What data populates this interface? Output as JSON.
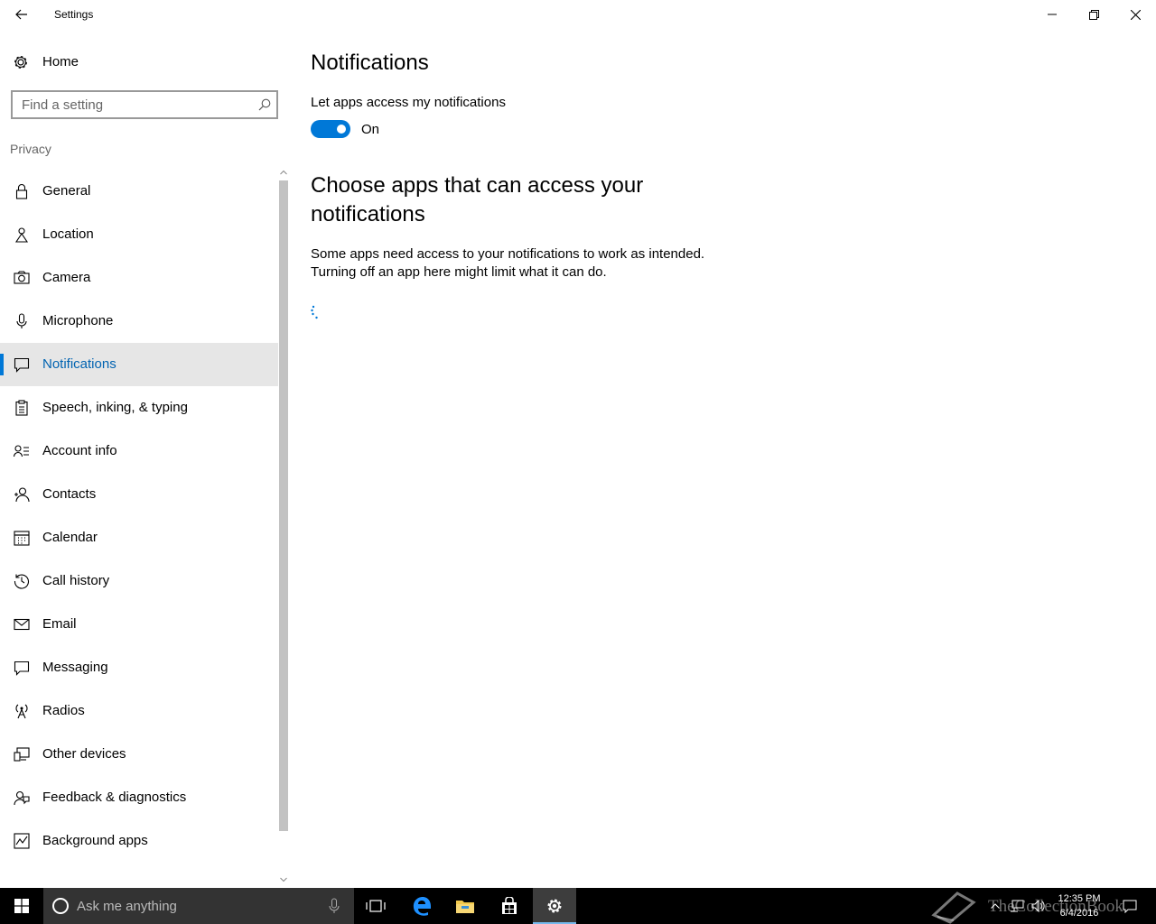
{
  "window": {
    "title": "Settings"
  },
  "sidebar": {
    "home_label": "Home",
    "search_placeholder": "Find a setting",
    "section_label": "Privacy",
    "items": [
      {
        "label": "General",
        "icon": "lock-icon"
      },
      {
        "label": "Location",
        "icon": "location-icon"
      },
      {
        "label": "Camera",
        "icon": "camera-icon"
      },
      {
        "label": "Microphone",
        "icon": "microphone-icon"
      },
      {
        "label": "Notifications",
        "icon": "notification-icon",
        "selected": true
      },
      {
        "label": "Speech, inking, & typing",
        "icon": "clipboard-icon"
      },
      {
        "label": "Account info",
        "icon": "account-info-icon"
      },
      {
        "label": "Contacts",
        "icon": "contacts-icon"
      },
      {
        "label": "Calendar",
        "icon": "calendar-icon"
      },
      {
        "label": "Call history",
        "icon": "history-icon"
      },
      {
        "label": "Email",
        "icon": "email-icon"
      },
      {
        "label": "Messaging",
        "icon": "messaging-icon"
      },
      {
        "label": "Radios",
        "icon": "radio-tower-icon"
      },
      {
        "label": "Other devices",
        "icon": "devices-icon"
      },
      {
        "label": "Feedback & diagnostics",
        "icon": "feedback-icon"
      },
      {
        "label": "Background apps",
        "icon": "background-apps-icon"
      }
    ]
  },
  "main": {
    "title": "Notifications",
    "toggle_label": "Let apps access my notifications",
    "toggle_state": "On",
    "toggle_on": true,
    "subheading": "Choose apps that can access your notifications",
    "description_line1": "Some apps need access to your notifications to work as intended.",
    "description_line2": "Turning off an app here might limit what it can do."
  },
  "taskbar": {
    "search_placeholder": "Ask me anything",
    "time": "12:35 PM",
    "date": "6/4/2016",
    "watermark": "TheCollectionBook"
  },
  "colors": {
    "accent": "#0078d7",
    "selected_text": "#0063b1",
    "selected_bg": "#e6e6e6",
    "taskbar": "#000000"
  }
}
